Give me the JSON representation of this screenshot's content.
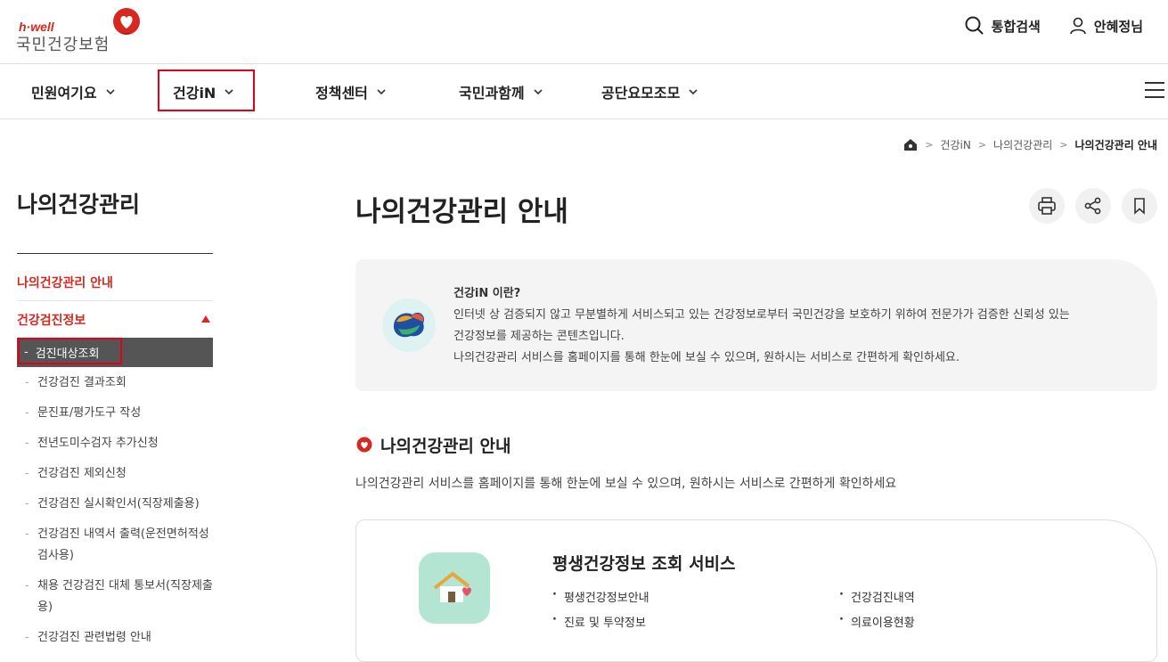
{
  "header": {
    "logo_sub": "h·well",
    "logo_main": "국민건강보험",
    "search_label": "통합검색",
    "user_label": "안혜정님"
  },
  "gnb": {
    "items": [
      "민원여기요",
      "건강iN",
      "정책센터",
      "국민과함께",
      "공단요모조모"
    ]
  },
  "breadcrumb": {
    "items": [
      "건강iN",
      "나의건강관리",
      "나의건강관리 안내"
    ]
  },
  "sidebar": {
    "title": "나의건강관리",
    "link_guide": "나의건강관리 안내",
    "link_checkup": "건강검진정보",
    "active_item": "검진대상조회",
    "items": [
      "건강검진 결과조회",
      "문진표/평가도구 작성",
      "전년도미수검자 추가신청",
      "건강검진 제외신청",
      "건강검진 실시확인서(직장제출용)",
      "건강검진 내역서 출력(운전면허적성검사용)",
      "채용 건강검진 대체 통보서(직장제출용)",
      "건강검진 관련법령 안내"
    ]
  },
  "main": {
    "title": "나의건강관리 안내",
    "info": {
      "question": "건강iN 이란?",
      "line1": "인터넷 상 검증되지 않고 무분별하게 서비스되고 있는 건강정보로부터 국민건강을 보호하기 위하여 전문가가 검증한 신뢰성 있는",
      "line2": "건강정보를 제공하는 콘텐츠입니다.",
      "line3": "나의건강관리 서비스를 홈페이지를 통해 한눈에 보실 수 있으며, 원하시는 서비스로 간편하게 확인하세요."
    },
    "section_title": "나의건강관리 안내",
    "section_desc": "나의건강관리 서비스를 홈페이지를 통해 한눈에 보실 수 있으며, 원하시는 서비스로 간편하게 확인하세요",
    "card": {
      "title": "평생건강정보 조회 서비스",
      "items": [
        "평생건강정보안내",
        "건강검진내역",
        "진료 및 투약정보",
        "의료이용현황"
      ]
    }
  },
  "colors": {
    "brand_red": "#d6281f",
    "highlight_box": "#e2001a",
    "active_bg": "#555555"
  }
}
